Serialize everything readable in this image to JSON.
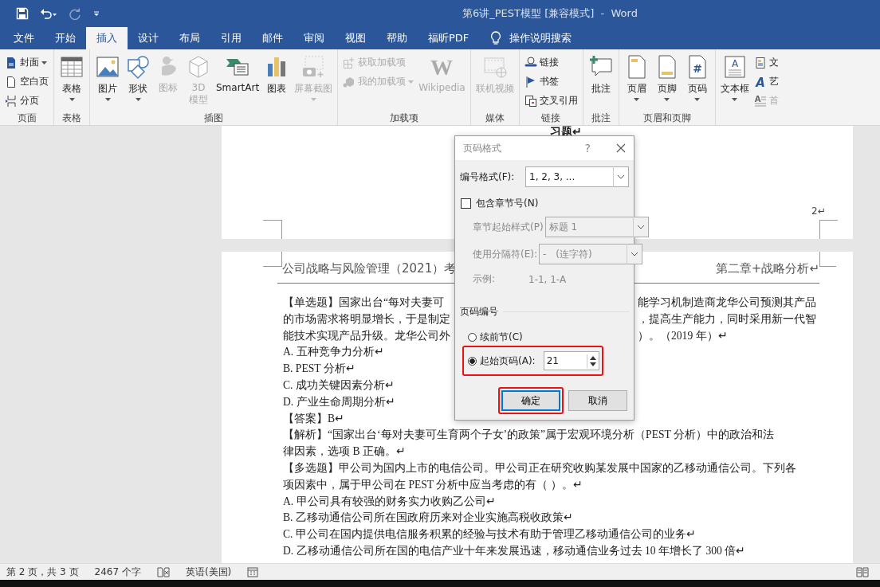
{
  "window": {
    "title": "第6讲_PEST模型 [兼容模式]  -  Word"
  },
  "tabs": [
    {
      "label": "文件",
      "selected": false
    },
    {
      "label": "开始",
      "selected": false
    },
    {
      "label": "插入",
      "selected": true
    },
    {
      "label": "设计",
      "selected": false
    },
    {
      "label": "布局",
      "selected": false
    },
    {
      "label": "引用",
      "selected": false
    },
    {
      "label": "邮件",
      "selected": false
    },
    {
      "label": "审阅",
      "selected": false
    },
    {
      "label": "视图",
      "selected": false
    },
    {
      "label": "帮助",
      "selected": false
    },
    {
      "label": "福昕PDF",
      "selected": false
    }
  ],
  "tell_me": {
    "label": "操作说明搜索"
  },
  "ribbon": [
    {
      "label": "页面",
      "items": [
        {
          "kind": "small",
          "label": "封面",
          "dropdown": true,
          "disabled": false
        },
        {
          "kind": "small",
          "label": "空白页",
          "dropdown": false,
          "disabled": false
        },
        {
          "kind": "small",
          "label": "分页",
          "dropdown": false,
          "disabled": false
        }
      ]
    },
    {
      "label": "表格",
      "items": [
        {
          "kind": "large",
          "label": "表格",
          "dropdown": true,
          "disabled": false
        }
      ]
    },
    {
      "label": "插图",
      "items": [
        {
          "kind": "large",
          "label": "图片",
          "dropdown": true,
          "disabled": false
        },
        {
          "kind": "large",
          "label": "形状",
          "dropdown": true,
          "disabled": false
        },
        {
          "kind": "narrow",
          "label": "图标",
          "dropdown": false,
          "disabled": true
        },
        {
          "kind": "narrow",
          "label": "3D模型",
          "dropdown": false,
          "disabled": true
        },
        {
          "kind": "large",
          "label": "SmartArt",
          "dropdown": false,
          "disabled": false
        },
        {
          "kind": "large",
          "label": "图表",
          "dropdown": false,
          "disabled": false
        },
        {
          "kind": "large",
          "label": "屏幕截图",
          "dropdown": true,
          "disabled": true
        }
      ]
    },
    {
      "label": "加载项",
      "items": [
        {
          "kind": "small",
          "label": "获取加载项",
          "dropdown": false,
          "disabled": true
        },
        {
          "kind": "small",
          "label": "我的加载项",
          "dropdown": true,
          "disabled": true
        },
        {
          "kind": "large",
          "label": "Wikipedia",
          "glyph": "W",
          "dropdown": false,
          "disabled": true
        }
      ]
    },
    {
      "label": "媒体",
      "items": [
        {
          "kind": "large",
          "label": "联机视频",
          "dropdown": false,
          "disabled": true
        }
      ]
    },
    {
      "label": "链接",
      "items": [
        {
          "kind": "small",
          "label": "链接",
          "dropdown": false,
          "disabled": false
        },
        {
          "kind": "small",
          "label": "书签",
          "dropdown": false,
          "disabled": false
        },
        {
          "kind": "small",
          "label": "交叉引用",
          "dropdown": false,
          "disabled": false
        }
      ]
    },
    {
      "label": "批注",
      "items": [
        {
          "kind": "large",
          "label": "批注",
          "dropdown": false,
          "disabled": false
        }
      ]
    },
    {
      "label": "页眉和页脚",
      "items": [
        {
          "kind": "large",
          "label": "页眉",
          "dropdown": true,
          "disabled": false
        },
        {
          "kind": "large",
          "label": "页脚",
          "dropdown": true,
          "disabled": false
        },
        {
          "kind": "large",
          "label": "页码",
          "glyph": "#",
          "dropdown": true,
          "disabled": false
        }
      ]
    },
    {
      "items": [
        {
          "kind": "large",
          "label": "文本框",
          "glyph": "A",
          "dropdown": true,
          "disabled": false
        },
        {
          "kind": "small",
          "label": "文",
          "dropdown": false,
          "disabled": false
        },
        {
          "kind": "small",
          "label": "艺",
          "glyph": "A",
          "dropdown": false,
          "disabled": false
        },
        {
          "kind": "small",
          "label": "首",
          "glyph": "A",
          "dropdown": false,
          "disabled": true
        }
      ]
    }
  ],
  "page_1": {
    "heading": "习题↵",
    "page_number": "2↵"
  },
  "page_2": {
    "header_left": "公司战略与风险管理（2021）考",
    "header_right": "第二章+战略分析↵",
    "lines": [
      {
        "left": "【单选题】国家出台“每对夫妻可",
        "right": "能学习机制造商龙华公司预测其产品"
      },
      {
        "left": "的市场需求将明显增长，于是制定",
        "right": "，提高生产能力，同时采用新一代智"
      },
      {
        "left": "能技术实现产品升级。龙华公司外",
        "right": "）。（2019 年）↵"
      },
      {
        "left": "A. 五种竞争力分析↵"
      },
      {
        "left": "B. PEST 分析↵"
      },
      {
        "left": "C. 成功关键因素分析↵"
      },
      {
        "left": "D. 产业生命周期分析↵"
      },
      {
        "left": "【答案】B↵"
      },
      {
        "left": "【解析】“国家出台‘每对夫妻可生育两个子女’的政策”属于宏观环境分析（PEST 分析）中的政治和法"
      },
      {
        "left": "律因素，选项 B 正确。↵"
      },
      {
        "left": "【多选题】甲公司为国内上市的电信公司。甲公司正在研究收购某发展中国家的乙移动通信公司。下列各"
      },
      {
        "left": "项因素中，属于甲公司在 PEST 分析中应当考虑的有（ ）。↵"
      },
      {
        "left": "A. 甲公司具有较强的财务实力收购乙公司↵"
      },
      {
        "left": "B. 乙移动通信公司所在国政府历来对企业实施高税收政策↵"
      },
      {
        "left": "C. 甲公司在国内提供电信服务积累的经验与技术有助于管理乙移动通信公司的业务↵"
      },
      {
        "left": "D. 乙移动通信公司所在国的电信产业十年来发展迅速，移动通信业务过去 10 年增长了 300 倍↵"
      }
    ]
  },
  "dialog": {
    "title": "页码格式",
    "help": "?",
    "number_format": {
      "label": "编号格式(F):",
      "value": "1, 2, 3, ..."
    },
    "include_chapter": {
      "label": "包含章节号(N)",
      "checked": false
    },
    "chapter_style": {
      "label": "章节起始样式(P)",
      "value": "标题 1",
      "disabled": true
    },
    "separator": {
      "label": "使用分隔符(E):",
      "value": "-　(连字符)",
      "disabled": true
    },
    "example": {
      "label": "示例:",
      "value": "1-1, 1-A",
      "disabled": true
    },
    "section": "页码编号",
    "options": [
      {
        "label": "续前节(C)",
        "selected": false,
        "highlighted": false
      },
      {
        "label": "起始页码(A):",
        "selected": true,
        "highlighted": true
      }
    ],
    "start_at": {
      "value": "21"
    },
    "buttons": [
      {
        "label": "确定",
        "default": true,
        "highlighted": true
      },
      {
        "label": "取消",
        "default": false,
        "highlighted": false
      }
    ]
  },
  "status_bar": {
    "page": "第 2 页，共 3 页",
    "words": "2467 个字",
    "language": "英语(美国)"
  }
}
